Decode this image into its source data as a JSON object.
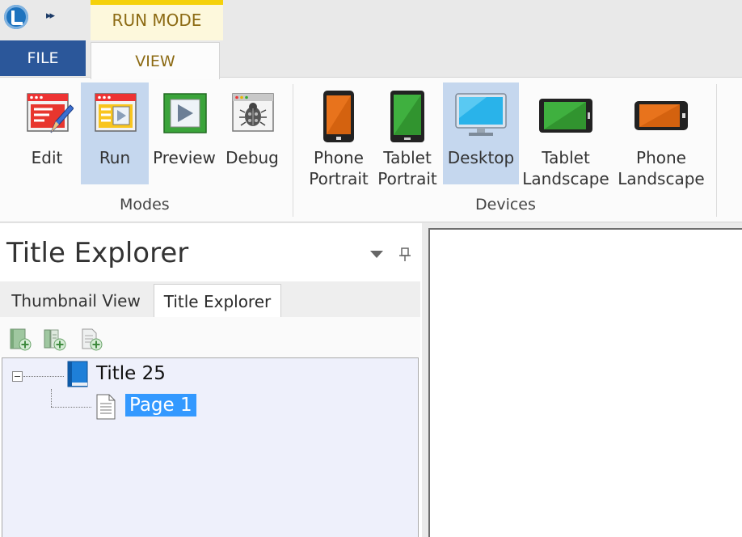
{
  "titlebar": {
    "qat_more": "▸▸"
  },
  "ribbon_tabs": {
    "context_group": "RUN MODE",
    "file": "FILE",
    "view": "VIEW"
  },
  "ribbon": {
    "modes": {
      "label": "Modes",
      "buttons": [
        {
          "label": "Edit",
          "icon": "edit-icon",
          "active": false
        },
        {
          "label": "Run",
          "icon": "run-icon",
          "active": true
        },
        {
          "label": "Preview",
          "icon": "preview-icon",
          "active": false
        },
        {
          "label": "Debug",
          "icon": "debug-icon",
          "active": false
        }
      ]
    },
    "devices": {
      "label": "Devices",
      "buttons": [
        {
          "line1": "Phone",
          "line2": "Portrait",
          "icon": "phone-portrait-icon",
          "active": false
        },
        {
          "line1": "Tablet",
          "line2": "Portrait",
          "icon": "tablet-portrait-icon",
          "active": false
        },
        {
          "line1": "Desktop",
          "line2": "",
          "icon": "desktop-icon",
          "active": true
        },
        {
          "line1": "Tablet",
          "line2": "Landscape",
          "icon": "tablet-landscape-icon",
          "active": false
        },
        {
          "line1": "Phone",
          "line2": "Landscape",
          "icon": "phone-landscape-icon",
          "active": false
        }
      ]
    }
  },
  "panel": {
    "title": "Title Explorer",
    "tabs": [
      {
        "label": "Thumbnail View",
        "selected": false
      },
      {
        "label": "Title Explorer",
        "selected": true
      }
    ],
    "tree": {
      "root": {
        "label": "Title 25",
        "icon": "book-icon",
        "expanded": true
      },
      "children": [
        {
          "label": "Page 1",
          "icon": "page-icon",
          "selected": true
        }
      ]
    }
  },
  "colors": {
    "accent_file_tab": "#2b579a",
    "context_yellow": "#f5d10a",
    "active_button": "#c5d7ee",
    "selection": "#3399ff"
  }
}
